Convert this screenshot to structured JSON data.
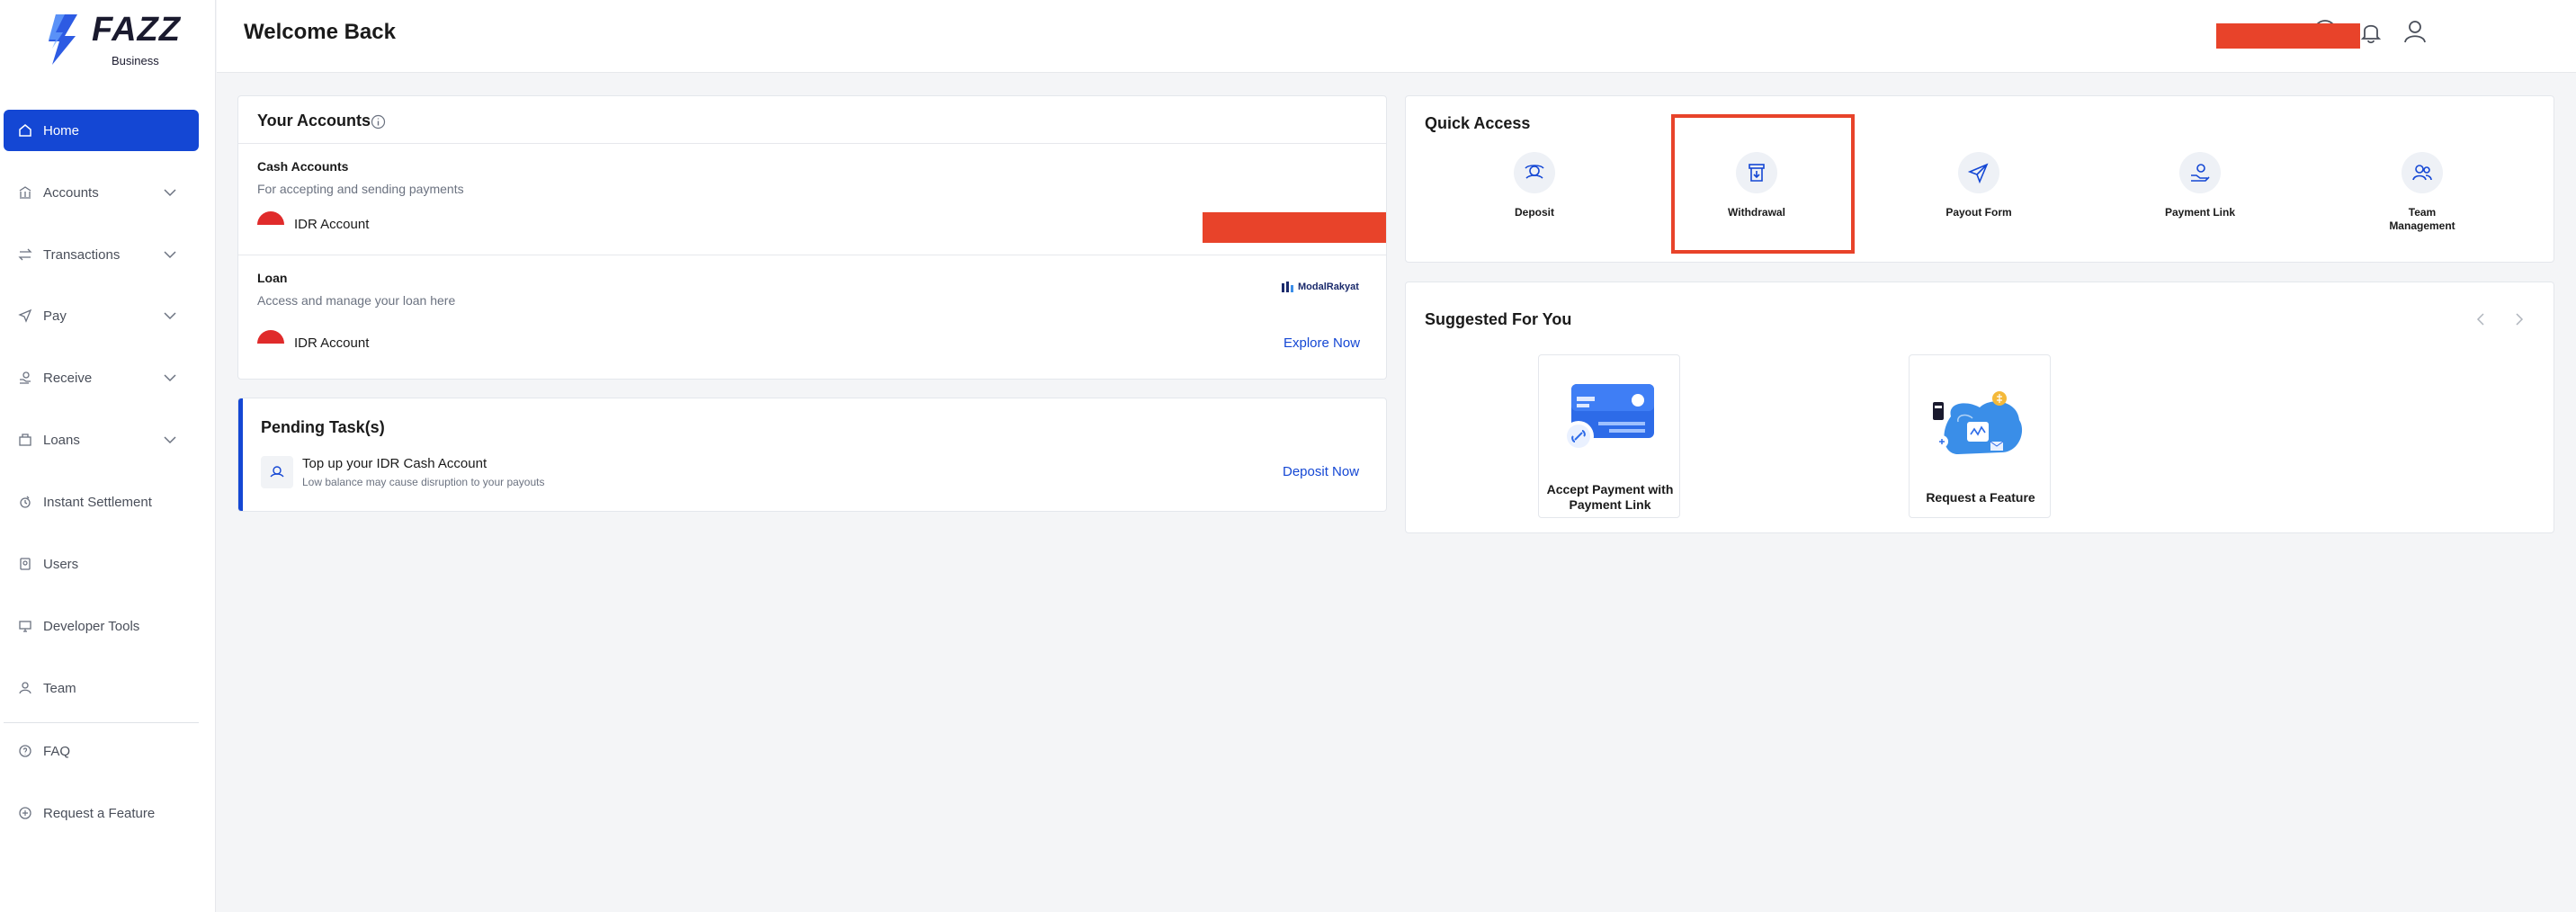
{
  "brand": {
    "name": "FAZZ",
    "sub": "Business"
  },
  "sidebar": {
    "items": [
      {
        "label": "Home"
      },
      {
        "label": "Accounts"
      },
      {
        "label": "Transactions"
      },
      {
        "label": "Pay"
      },
      {
        "label": "Receive"
      },
      {
        "label": "Loans"
      },
      {
        "label": "Instant Settlement"
      },
      {
        "label": "Users"
      },
      {
        "label": "Developer Tools"
      },
      {
        "label": "Team"
      },
      {
        "label": "FAQ"
      },
      {
        "label": "Request a Feature"
      }
    ]
  },
  "header": {
    "title": "Welcome Back"
  },
  "accounts": {
    "title": "Your Accounts",
    "cash": {
      "title": "Cash Accounts",
      "desc": "For accepting and sending payments",
      "account": "IDR Account"
    },
    "loan": {
      "title": "Loan",
      "desc": "Access and manage your loan here",
      "account": "IDR Account",
      "partner": "ModalRakyat",
      "action": "Explore Now"
    }
  },
  "pending": {
    "title": "Pending Task(s)",
    "task_title": "Top up your IDR Cash Account",
    "task_desc": "Low balance may cause disruption to your payouts",
    "action": "Deposit Now"
  },
  "quick_access": {
    "title": "Quick Access",
    "items": [
      {
        "label": "Deposit"
      },
      {
        "label": "Withdrawal"
      },
      {
        "label": "Payout Form"
      },
      {
        "label": "Payment Link"
      },
      {
        "label": "Team Management"
      }
    ]
  },
  "suggested": {
    "title": "Suggested For You",
    "cards": [
      {
        "label": "Accept Payment with Payment Link"
      },
      {
        "label": "Request a Feature"
      }
    ]
  },
  "colors": {
    "accent": "#1447d4",
    "redaction": "#e8432a"
  }
}
